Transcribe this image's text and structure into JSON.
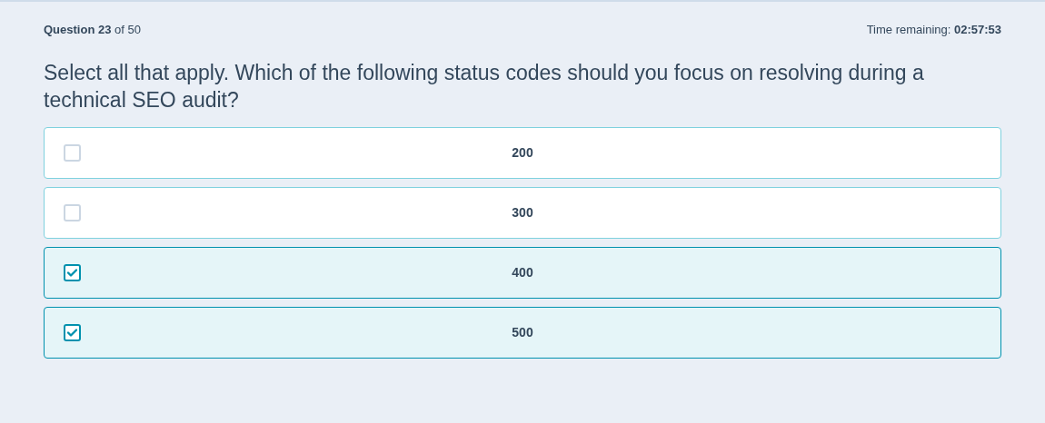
{
  "header": {
    "progress": "**Question 23** of 50",
    "timer": "Time remaining: **02:57:53**"
  },
  "question": "Select all that apply. Which of the following status codes should you focus on resolving during a technical SEO audit?",
  "options": [
    {
      "label": "200",
      "checked": false
    },
    {
      "label": "300",
      "checked": false
    },
    {
      "label": "400",
      "checked": true
    },
    {
      "label": "500",
      "checked": true
    }
  ]
}
